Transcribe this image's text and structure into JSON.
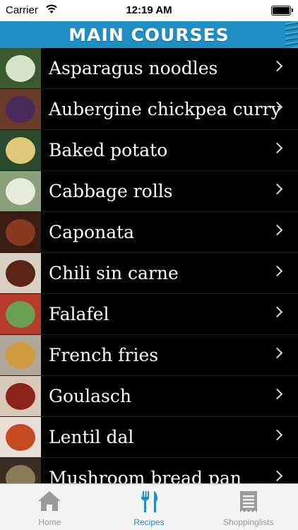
{
  "status_bar": {
    "carrier": "Carrier",
    "time": "12:19 AM"
  },
  "header": {
    "title": "MAIN COURSES"
  },
  "recipes": [
    {
      "name": "Asparagus noodles",
      "thumb_bg": "#3a5a30",
      "dish": "#d8e4c8"
    },
    {
      "name": "Aubergine chickpea curry",
      "thumb_bg": "#6b3b2a",
      "dish": "#4a2a5a"
    },
    {
      "name": "Baked potato",
      "thumb_bg": "#2a4a2e",
      "dish": "#e0c878"
    },
    {
      "name": "Cabbage rolls",
      "thumb_bg": "#8aa07a",
      "dish": "#e8ecdc"
    },
    {
      "name": "Caponata",
      "thumb_bg": "#3a1e14",
      "dish": "#8a3a1c"
    },
    {
      "name": "Chili sin carne",
      "thumb_bg": "#d8d0c4",
      "dish": "#5a2418"
    },
    {
      "name": "Falafel",
      "thumb_bg": "#b83a2a",
      "dish": "#6aa050"
    },
    {
      "name": "French fries",
      "thumb_bg": "#b0a898",
      "dish": "#d09a40"
    },
    {
      "name": "Goulasch",
      "thumb_bg": "#d8c8b8",
      "dish": "#8a2418"
    },
    {
      "name": "Lentil dal",
      "thumb_bg": "#e8e0d8",
      "dish": "#c44a22"
    },
    {
      "name": "Mushroom bread pan",
      "thumb_bg": "#3a2e24",
      "dish": "#8a7a5a"
    }
  ],
  "tabbar": {
    "tabs": [
      {
        "label": "Home",
        "icon": "home-icon"
      },
      {
        "label": "Recipes",
        "icon": "cutlery-icon",
        "active": true
      },
      {
        "label": "Shoppinglists",
        "icon": "receipt-icon"
      }
    ]
  },
  "colors": {
    "accent": "#1f8ec4"
  }
}
